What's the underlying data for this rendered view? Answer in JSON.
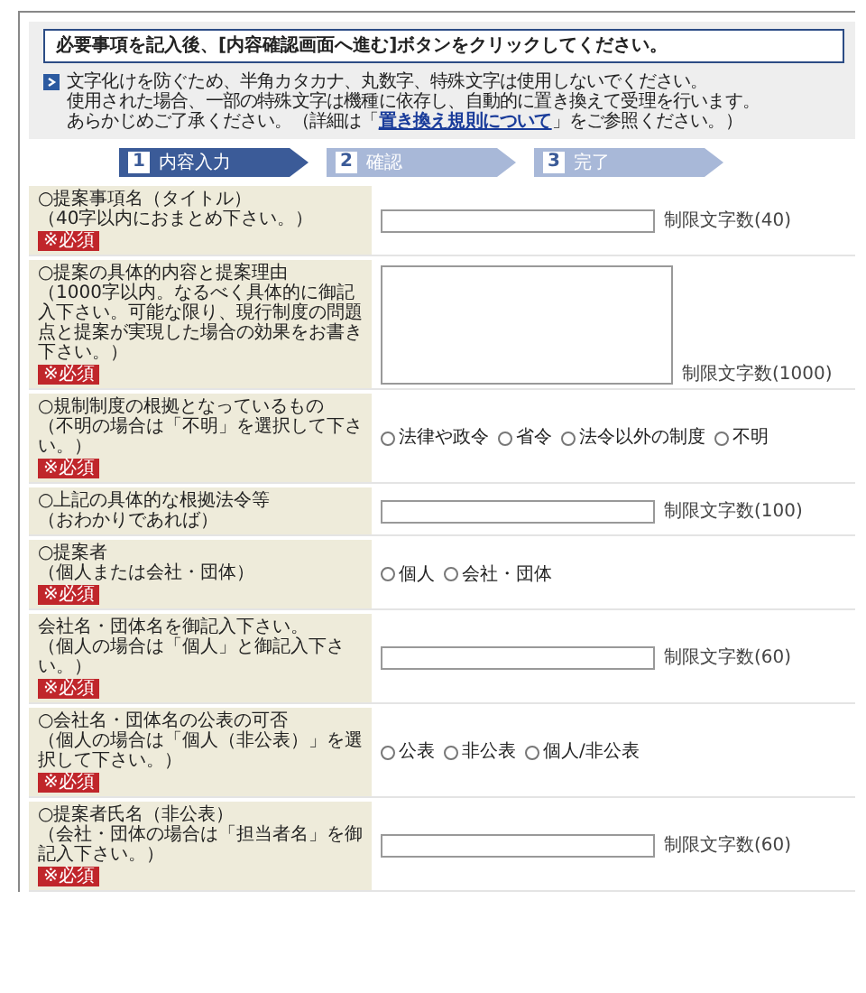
{
  "instruction": "必要事項を記入後、[内容確認画面へ進む]ボタンをクリックしてください。",
  "notes": [
    "文字化けを防ぐため、半角カタカナ、丸数字、特殊文字は使用しないでください。",
    "使用された場合、一部の特殊文字は機種に依存し、自動的に置き換えて受理を行います。"
  ],
  "note_link_line": {
    "before": "あらかじめご了承ください。（詳細は「",
    "link": "置き換え規則について",
    "after": "」をご参照ください。）"
  },
  "steps": [
    {
      "number": "1",
      "label": "内容入力",
      "selected": true
    },
    {
      "number": "2",
      "label": "確認",
      "selected": false
    },
    {
      "number": "3",
      "label": "完了",
      "selected": false
    }
  ],
  "fields": [
    {
      "kind": "text",
      "label": "○提案事項名（タイトル）",
      "hint": "（40字以内におまとめ下さい。）",
      "required": true,
      "badge": "※必須",
      "limit": "制限文字数(40)"
    },
    {
      "kind": "textarea",
      "label": "○提案の具体的内容と提案理由",
      "hint": "（1000字以内。なるべく具体的に御記入下さい。可能な限り、現行制度の問題点と提案が実現した場合の効果をお書き下さい。）",
      "required": true,
      "badge": "※必須",
      "limit": "制限文字数(1000)"
    },
    {
      "kind": "radio",
      "label": "○規制制度の根拠となっているもの",
      "hint": "（不明の場合は「不明」を選択して下さい。）",
      "required": true,
      "badge": "※必須",
      "options": [
        {
          "label": "法律や政令",
          "selected": false
        },
        {
          "label": "省令",
          "selected": false
        },
        {
          "label": "法令以外の制度",
          "selected": false
        },
        {
          "label": "不明",
          "selected": false
        }
      ]
    },
    {
      "kind": "text",
      "label": "○上記の具体的な根拠法令等",
      "hint": "（おわかりであれば）",
      "required": false,
      "limit": "制限文字数(100)"
    },
    {
      "kind": "radio",
      "label": "○提案者",
      "hint": "（個人または会社・団体）",
      "required": true,
      "badge": "※必須",
      "options": [
        {
          "label": "個人",
          "selected": false
        },
        {
          "label": "会社・団体",
          "selected": false
        }
      ]
    },
    {
      "kind": "text",
      "label": "会社名・団体名を御記入下さい。",
      "hint": "（個人の場合は「個人」と御記入下さい。）",
      "required": true,
      "badge": "※必須",
      "limit": "制限文字数(60)"
    },
    {
      "kind": "radio",
      "label": "○会社名・団体名の公表の可否",
      "hint": "（個人の場合は「個人（非公表）」を選択して下さい。）",
      "required": true,
      "badge": "※必須",
      "options": [
        {
          "label": "公表",
          "selected": false
        },
        {
          "label": "非公表",
          "selected": false
        },
        {
          "label": "個人/非公表",
          "selected": false
        }
      ]
    },
    {
      "kind": "text",
      "label": "○提案者氏名（非公表）",
      "hint": "（会社・団体の場合は「担当者名」を御記入下さい。）",
      "required": true,
      "badge": "※必須",
      "limit": "制限文字数(60)"
    }
  ]
}
